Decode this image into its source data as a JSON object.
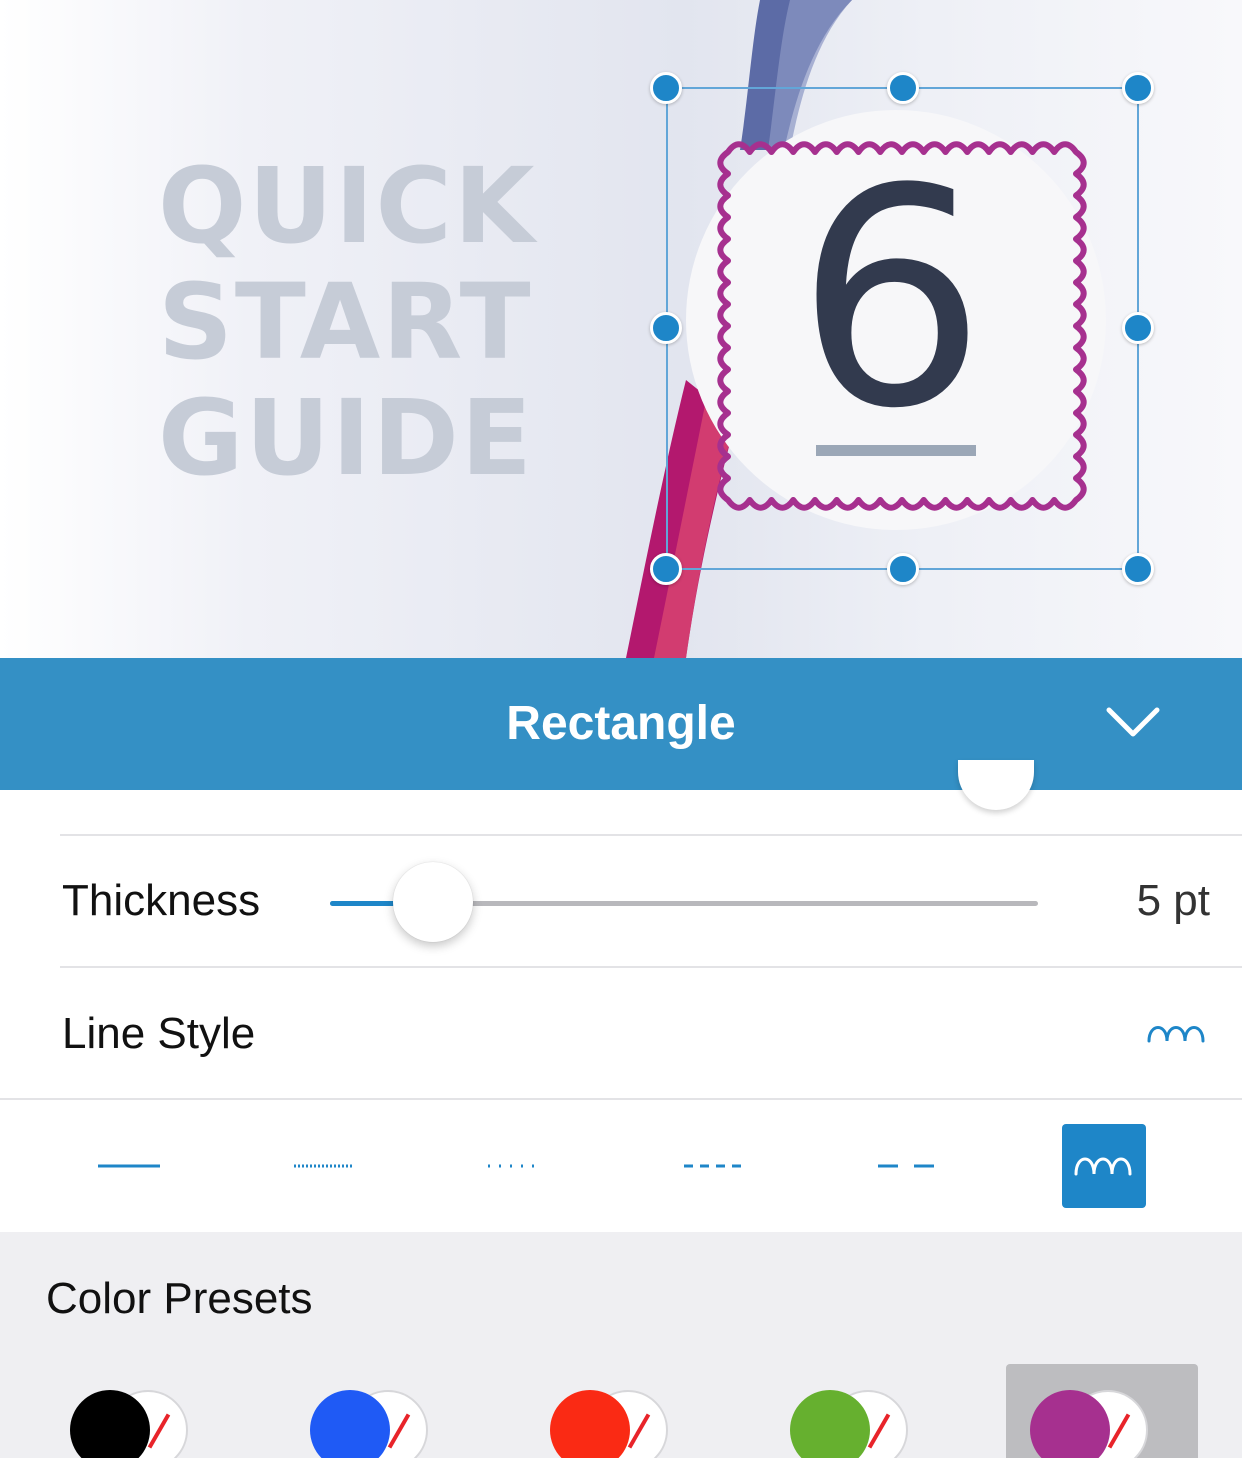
{
  "canvas": {
    "guide_title": "QUICK\nSTART\nGUIDE",
    "step_number": "6"
  },
  "panel": {
    "title": "Rectangle",
    "collapse_icon": "chevron-down-icon",
    "rows": {
      "thickness_label": "Thickness",
      "thickness_value": "5 pt",
      "thickness_fraction": 0.146,
      "line_style_label": "Line Style"
    },
    "line_styles": [
      {
        "name": "solid",
        "selected": false
      },
      {
        "name": "dotted-dense",
        "selected": false
      },
      {
        "name": "dotted-sparse",
        "selected": false
      },
      {
        "name": "dashed-short",
        "selected": false
      },
      {
        "name": "dashed-long",
        "selected": false
      },
      {
        "name": "cloudy",
        "selected": true
      }
    ]
  },
  "color_presets": {
    "title": "Color Presets",
    "items": [
      {
        "color": "#000000",
        "selected": false
      },
      {
        "color": "#1f5af5",
        "selected": false
      },
      {
        "color": "#fa2a14",
        "selected": false
      },
      {
        "color": "#66b02f",
        "selected": false
      },
      {
        "color": "#a6308f",
        "selected": true
      }
    ]
  },
  "colors": {
    "accent": "#3490c5",
    "handle": "#1e86c8",
    "annotation_stroke": "#a6308f"
  }
}
